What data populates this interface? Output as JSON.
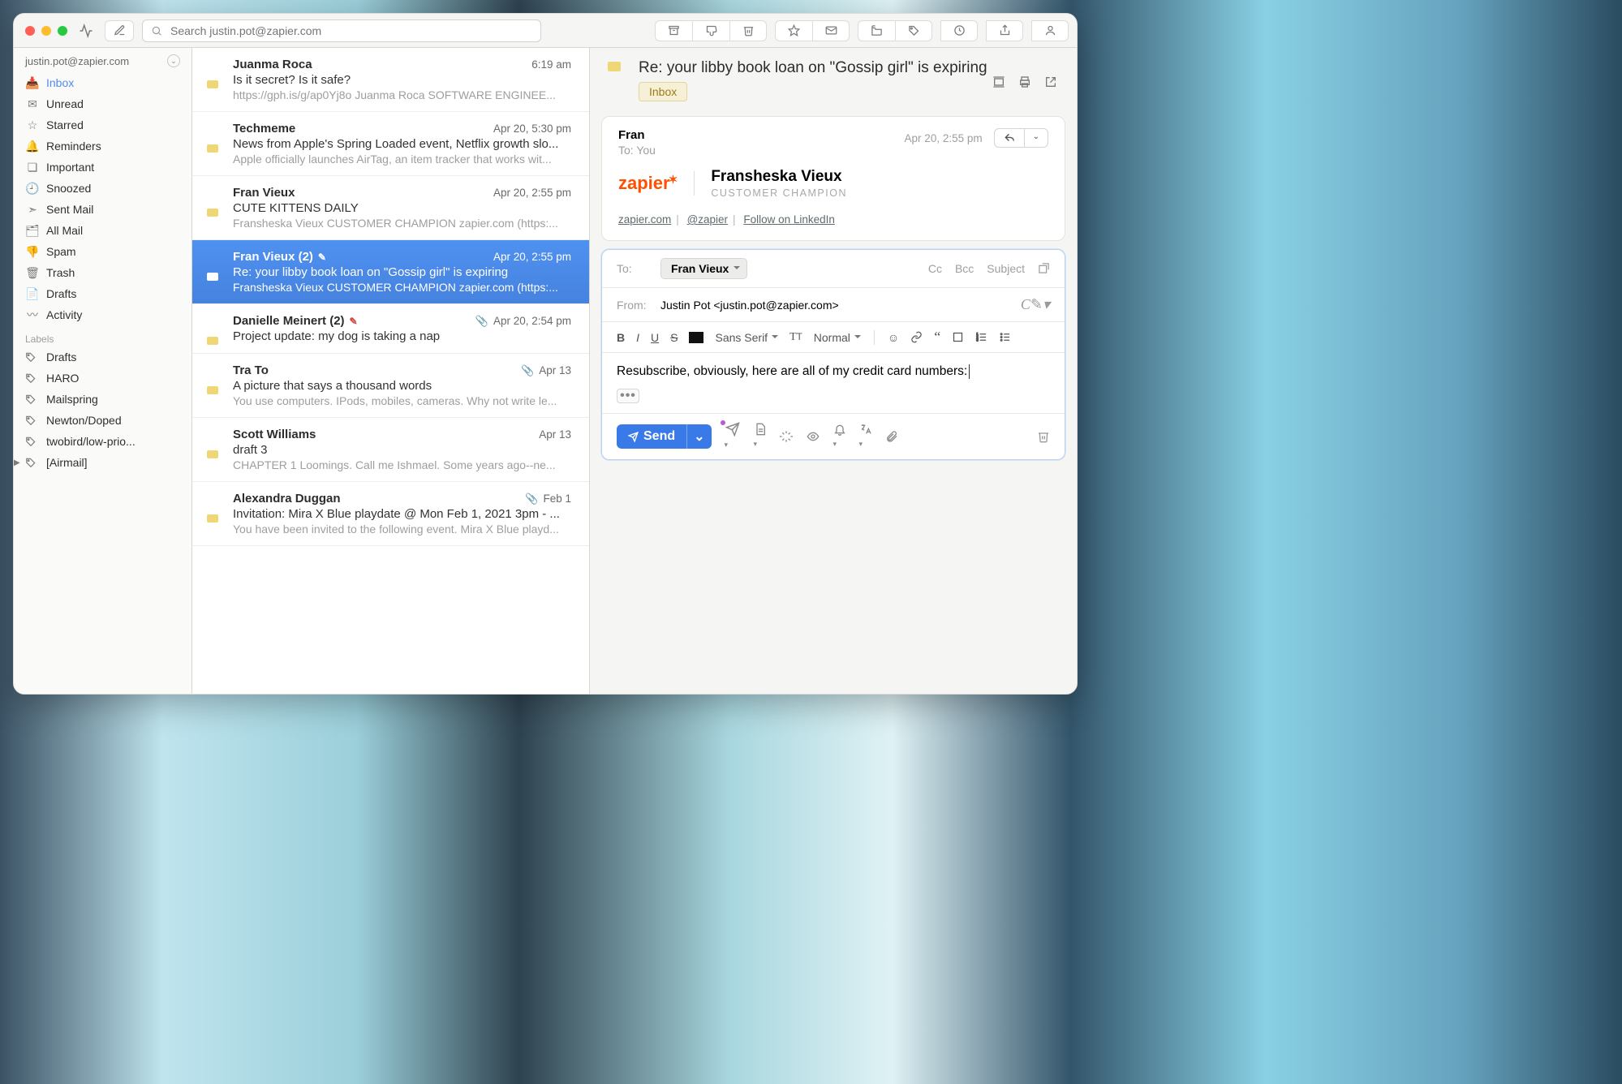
{
  "account": "justin.pot@zapier.com",
  "search_placeholder": "Search justin.pot@zapier.com",
  "sidebar": {
    "folders": [
      {
        "label": "Inbox",
        "icon": "📥"
      },
      {
        "label": "Unread",
        "icon": "✉︎"
      },
      {
        "label": "Starred",
        "icon": "☆"
      },
      {
        "label": "Reminders",
        "icon": "🔔"
      },
      {
        "label": "Important",
        "icon": "❏"
      },
      {
        "label": "Snoozed",
        "icon": "🕘"
      },
      {
        "label": "Sent Mail",
        "icon": "➣"
      },
      {
        "label": "All Mail",
        "icon": "🗂"
      },
      {
        "label": "Spam",
        "icon": "👎"
      },
      {
        "label": "Trash",
        "icon": "🗑"
      },
      {
        "label": "Drafts",
        "icon": "📄"
      },
      {
        "label": "Activity",
        "icon": "〰︎"
      }
    ],
    "labels_header": "Labels",
    "labels": [
      {
        "label": "Drafts"
      },
      {
        "label": "HARO"
      },
      {
        "label": "Mailspring"
      },
      {
        "label": "Newton/Doped"
      },
      {
        "label": "twobird/low-prio..."
      },
      {
        "label": "[Airmail]",
        "expandable": true
      }
    ]
  },
  "messages": [
    {
      "from": "Juanma Roca",
      "date": "6:19 am",
      "subject": "Is it secret? Is it safe?",
      "preview": "https://gph.is/g/ap0Yj8o Juanma Roca SOFTWARE ENGINEE..."
    },
    {
      "from": "Techmeme",
      "date": "Apr 20, 5:30 pm",
      "subject": "News from Apple's Spring Loaded event, Netflix growth slo...",
      "preview": "Apple officially launches AirTag, an item tracker that works wit..."
    },
    {
      "from": "Fran Vieux",
      "date": "Apr 20, 2:55 pm",
      "subject": "CUTE KITTENS DAILY",
      "preview": "Fransheska Vieux CUSTOMER CHAMPION zapier.com (https:..."
    },
    {
      "from": "Fran Vieux (2)",
      "date": "Apr 20, 2:55 pm",
      "subject": "Re: your libby book loan on \"Gossip girl\" is expiring",
      "preview": "Fransheska Vieux CUSTOMER CHAMPION zapier.com (https:...",
      "selected": true,
      "draft": true
    },
    {
      "from": "Danielle Meinert (2)",
      "date": "Apr 20, 2:54 pm",
      "subject": "Project update: my dog is taking a nap",
      "preview": "",
      "attach": true,
      "draft": true
    },
    {
      "from": "Tra To",
      "date": "Apr 13",
      "subject": "A picture that says a thousand words",
      "preview": "You use computers. IPods, mobiles, cameras. Why not write le...",
      "attach": true
    },
    {
      "from": "Scott Williams",
      "date": "Apr 13",
      "subject": "draft 3",
      "preview": "CHAPTER 1 Loomings. Call me Ishmael. Some years ago--ne..."
    },
    {
      "from": "Alexandra Duggan",
      "date": "Feb 1",
      "subject": "Invitation: Mira X Blue playdate @ Mon Feb 1, 2021 3pm - ...",
      "preview": "You have been invited to the following event. Mira X Blue playd...",
      "attach": true
    }
  ],
  "reader": {
    "subject": "Re: your libby book loan on \"Gossip girl\" is expiring",
    "folder_tag": "Inbox",
    "from": "Fran",
    "to_line": "To: You",
    "date": "Apr 20, 2:55 pm",
    "sig_name": "Fransheska Vieux",
    "sig_title": "CUSTOMER CHAMPION",
    "logo_text": "zapier",
    "links": {
      "site": "zapier.com",
      "twitter": "@zapier",
      "linkedin": "Follow on LinkedIn"
    }
  },
  "compose": {
    "to_label": "To:",
    "to_chip": "Fran Vieux",
    "extras": {
      "cc": "Cc",
      "bcc": "Bcc",
      "subject": "Subject"
    },
    "from_label": "From:",
    "from_value": "Justin Pot <justin.pot@zapier.com>",
    "font_family": "Sans Serif",
    "font_size": "Normal",
    "body": "Resubscribe, obviously, here are all of my credit card numbers:",
    "send_label": "Send"
  }
}
